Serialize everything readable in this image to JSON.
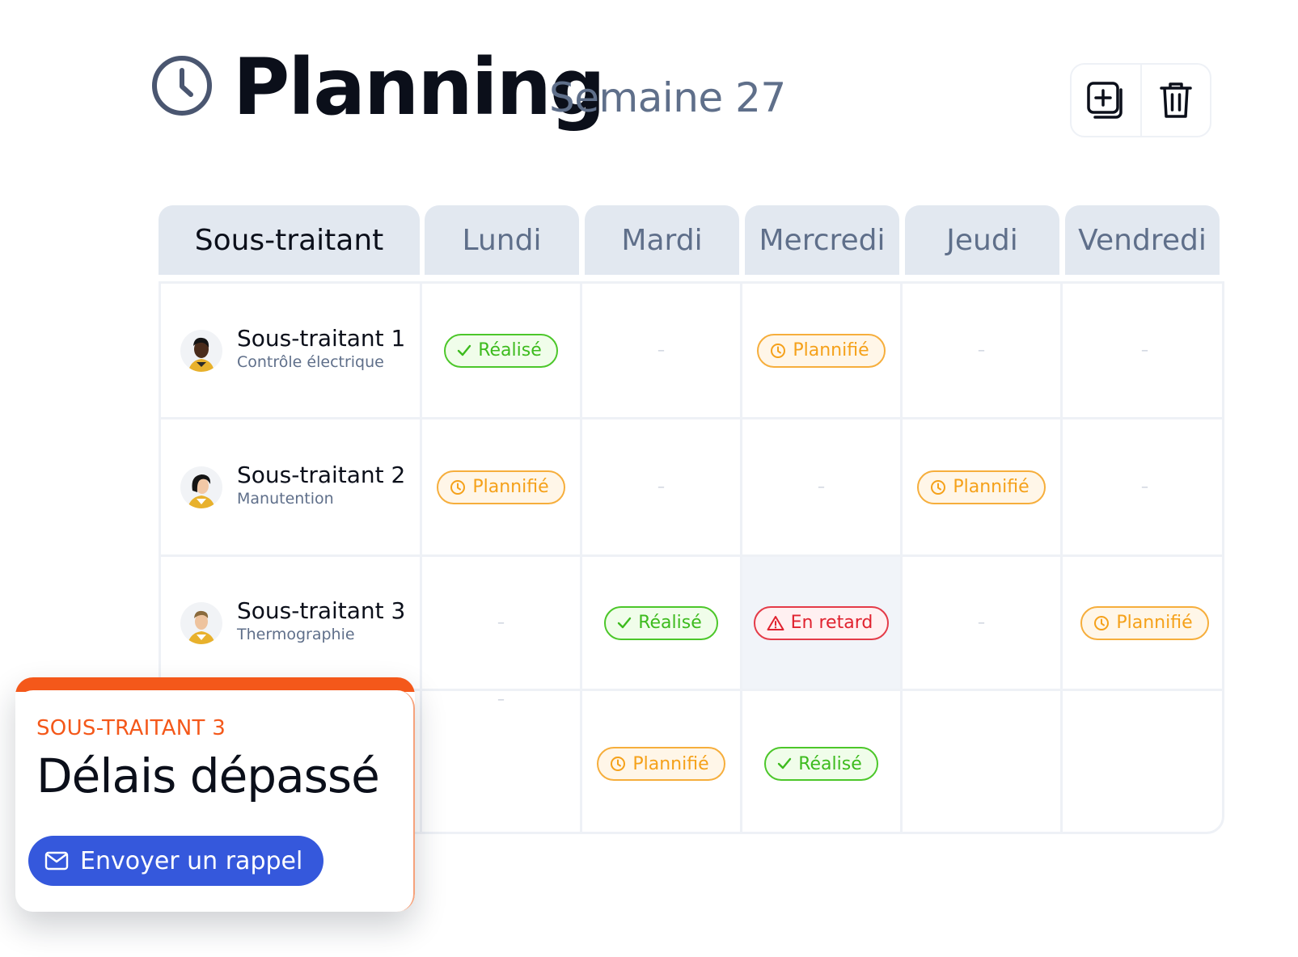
{
  "header": {
    "title": "Planning",
    "subtitle": "Semaine 27",
    "icon": "clock-icon"
  },
  "toolbar": {
    "add_icon": "add-copy-icon",
    "delete_icon": "trash-icon"
  },
  "columns": [
    "Sous-traitant",
    "Lundi",
    "Mardi",
    "Mercredi",
    "Jeudi",
    "Vendredi"
  ],
  "rows": [
    {
      "name": "Sous-traitant 1",
      "role": "Contrôle électrique",
      "cells": [
        {
          "status": "done",
          "label": "Réalisé"
        },
        {
          "status": "empty",
          "label": "–"
        },
        {
          "status": "planned",
          "label": "Plannifié"
        },
        {
          "status": "empty",
          "label": "–"
        },
        {
          "status": "empty",
          "label": "–"
        }
      ]
    },
    {
      "name": "Sous-traitant 2",
      "role": "Manutention",
      "cells": [
        {
          "status": "planned",
          "label": "Plannifié"
        },
        {
          "status": "empty",
          "label": "–"
        },
        {
          "status": "empty",
          "label": "–"
        },
        {
          "status": "planned",
          "label": "Plannifié"
        },
        {
          "status": "empty",
          "label": "–"
        }
      ]
    },
    {
      "name": "Sous-traitant 3",
      "role": "Thermographie",
      "cells": [
        {
          "status": "empty",
          "label": "–"
        },
        {
          "status": "done",
          "label": "Réalisé"
        },
        {
          "status": "late",
          "label": "En retard"
        },
        {
          "status": "empty",
          "label": "–"
        },
        {
          "status": "planned",
          "label": "Plannifié"
        }
      ]
    },
    {
      "name": "",
      "role": "",
      "cells": [
        {
          "status": "empty",
          "label": "–"
        },
        {
          "status": "planned",
          "label": "Plannifié"
        },
        {
          "status": "done",
          "label": "Réalisé"
        },
        {
          "status": "blank",
          "label": ""
        },
        {
          "status": "blank",
          "label": ""
        }
      ]
    }
  ],
  "notification": {
    "eyebrow": "SOUS-TRAITANT 3",
    "title": "Délais dépassé",
    "button_label": "Envoyer un rappel",
    "button_icon": "mail-icon"
  },
  "colors": {
    "done": "#3dbb1e",
    "planned": "#f5a11a",
    "late": "#e0222f",
    "accent": "#f4581a",
    "button": "#3558dc"
  }
}
